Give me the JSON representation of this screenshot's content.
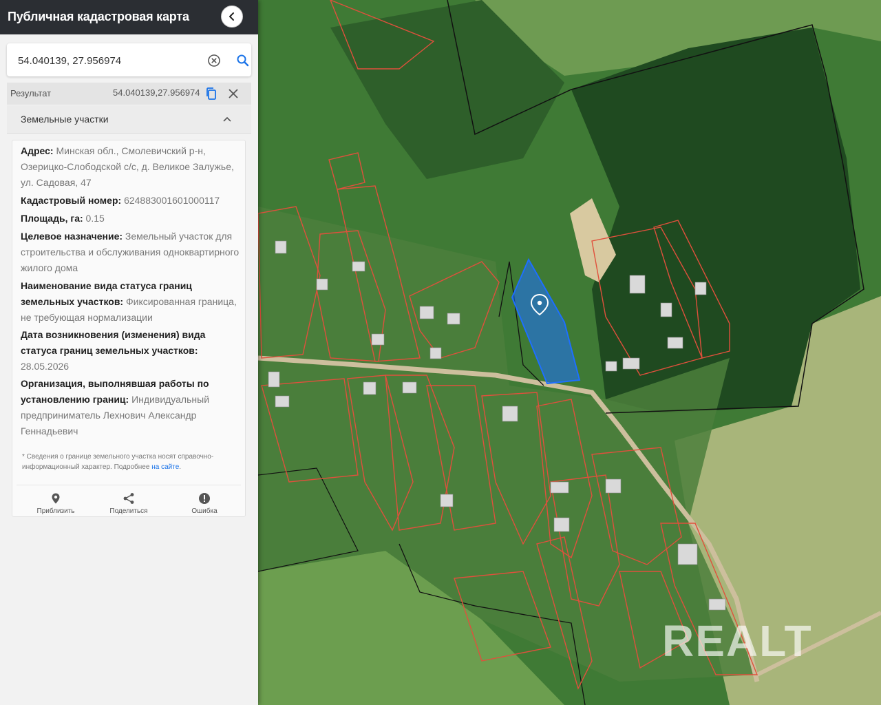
{
  "header": {
    "title": "Публичная кадастровая карта"
  },
  "search": {
    "value": "54.040139, 27.956974"
  },
  "result": {
    "label": "Результат",
    "coords": "54.040139,27.956974"
  },
  "section": {
    "title": "Земельные участки"
  },
  "parcel": {
    "address_label": "Адрес:",
    "address_value": "Минская обл., Смолевичский р-н, Озерицко-Слободской с/с, д. Великое Залужье, ул. Садовая, 47",
    "cadastral_label": "Кадастровый номер:",
    "cadastral_value": "624883001601000117",
    "area_label": "Площадь, га:",
    "area_value": "0.15",
    "purpose_label": "Целевое назначение:",
    "purpose_value": "Земельный участок для строительства и обслуживания одноквартирного жилого дома",
    "status_label": "Наименование вида статуса границ земельных участков:",
    "status_value": "Фиксированная граница, не требующая нормализации",
    "date_label": "Дата возникновения (изменения) вида статуса границ земельных участков:",
    "date_value": "28.05.2026",
    "org_label": "Организация, выполнявшая работы по установлению границ:",
    "org_value": "Индивидуальный предприниматель Лехнович Александр Геннадьевич"
  },
  "note": {
    "text": "* Сведения о границе земельного участка носят справочно-информационный характер. Подробнее ",
    "link": "на сайте",
    "end": "."
  },
  "actions": {
    "zoom": "Приблизить",
    "share": "Поделиться",
    "error": "Ошибка"
  },
  "watermark": "REALT",
  "colors": {
    "header_bg": "#2b2e33",
    "parcel_fill": "#1e6fff",
    "boundary_red": "#e0503c",
    "link_blue": "#1a73e8"
  }
}
